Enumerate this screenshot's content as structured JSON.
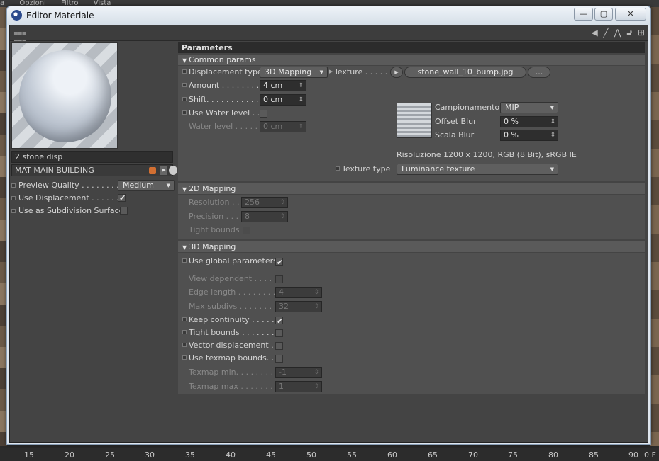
{
  "background": {
    "menu": [
      "a",
      "Opzioni",
      "Filtro",
      "Vista"
    ],
    "ruler": [
      "15",
      "20",
      "25",
      "30",
      "35",
      "40",
      "45",
      "50",
      "55",
      "60",
      "65",
      "70",
      "75",
      "80",
      "85",
      "90",
      "0 F"
    ]
  },
  "window": {
    "title": "Editor Materiale",
    "min": "—",
    "max": "▢",
    "close": "✕"
  },
  "left": {
    "material_name": "2 stone disp",
    "layer_name": "MAT MAIN BUILDING",
    "preview_quality_label": "Preview Quality . . . . . . . . .",
    "preview_quality_value": "Medium",
    "use_displacement_label": "Use Displacement . . . . . . .",
    "use_displacement": true,
    "use_subdiv_label": "Use as Subdivision Surface",
    "use_subdiv": false,
    "swatch_color": "#d26f32"
  },
  "params": {
    "header": "Parameters",
    "common": {
      "title": "Common params",
      "disp_type_label": "Displacement type",
      "disp_type_value": "3D Mapping",
      "amount_label": "Amount . . . . . . . . .",
      "amount_value": "4 cm",
      "shift_label": "Shift. . . . . . . . . . . .",
      "shift_value": "0 cm",
      "water_label": "Use Water level . .",
      "water_checked": false,
      "water_level_label": "Water level . . . . . .",
      "water_level_value": "0 cm",
      "texture_label": "Texture . . . . .",
      "texture_file": "stone_wall_10_bump.jpg",
      "texture_more": "...",
      "sampling_label": "Campionamento",
      "sampling_value": "MIP",
      "offset_blur_label": "Offset Blur",
      "offset_blur_value": "0 %",
      "scale_blur_label": "Scala Blur",
      "scale_blur_value": "0 %",
      "resolution_info": "Risoluzione 1200 x 1200, RGB (8 Bit), sRGB IE",
      "texture_type_label": "Texture type",
      "texture_type_value": "Luminance texture"
    },
    "mapping2d": {
      "title": "2D Mapping",
      "resolution_label": "Resolution . .",
      "resolution_value": "256",
      "precision_label": "Precision . . . .",
      "precision_value": "8",
      "tight_label": "Tight bounds",
      "tight_checked": false
    },
    "mapping3d": {
      "title": "3D Mapping",
      "global_label": "Use global parameters",
      "global_checked": true,
      "view_dep_label": "View dependent . . . .",
      "view_dep_checked": false,
      "edge_label": "Edge length . . . . . . . .",
      "edge_value": "4",
      "max_subdivs_label": "Max subdivs . . . . . . .",
      "max_subdivs_value": "32",
      "keep_label": "Keep continuity . . . . .",
      "keep_checked": true,
      "tight_label": "Tight bounds . . . . . . .",
      "tight_checked": false,
      "vector_label": "Vector displacement .",
      "vector_checked": false,
      "texmap_bounds_label": "Use texmap bounds. .",
      "texmap_bounds_checked": false,
      "texmap_min_label": "Texmap min. . . . . . . . .",
      "texmap_min_value": "-1",
      "texmap_max_label": "Texmap max . . . . . . . .",
      "texmap_max_value": "1"
    }
  }
}
